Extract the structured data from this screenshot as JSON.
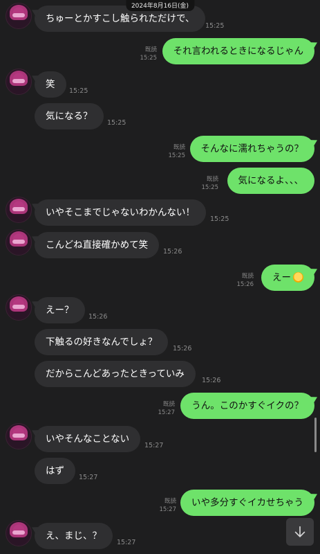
{
  "header": {
    "date": "2024年8月16日(金)"
  },
  "messages": [
    {
      "text": "ちゅーとかすこし触られただけで、",
      "time": "15:25"
    },
    {
      "text": "それ言われるときになるじゃん",
      "read": "既読",
      "time": "15:25"
    },
    {
      "text": "笑",
      "time": "15:25"
    },
    {
      "text": "気になる？",
      "time": "15:25"
    },
    {
      "text": "そんなに濡れちゃうの？",
      "read": "既読",
      "time": "15:25"
    },
    {
      "text": "気になるよ、、、",
      "read": "既読",
      "time": "15:25"
    },
    {
      "text": "いやそこまでじゃないわかんない！",
      "time": "15:25"
    },
    {
      "text": "こんどね直接確かめて笑",
      "time": "15:26"
    },
    {
      "text": "えー",
      "emoji": "scream-emoji-icon",
      "read": "既読",
      "time": "15:26"
    },
    {
      "text": "えー？",
      "time": "15:26"
    },
    {
      "text": "下触るの好きなんでしょ？",
      "time": "15:26"
    },
    {
      "text": "だからこんどあったときっていみ",
      "time": "15:26"
    },
    {
      "text": "うん。このかすぐイクの？",
      "read": "既読",
      "time": "15:27"
    },
    {
      "text": "いやそんなことない",
      "time": "15:27"
    },
    {
      "text": "はず",
      "time": "15:27"
    },
    {
      "text": "いや多分すぐイカせちゃう",
      "read": "既読",
      "time": "15:27"
    },
    {
      "text": "え、まじ、？",
      "time": "15:27"
    }
  ],
  "controls": {
    "scroll_down_icon": "arrow-down-icon"
  }
}
